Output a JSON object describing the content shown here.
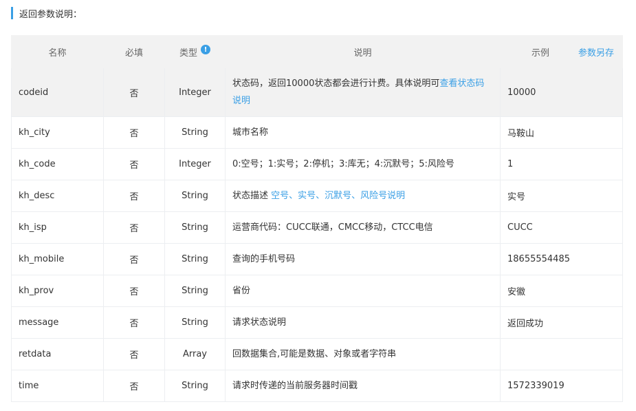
{
  "section": {
    "title": "返回参数说明："
  },
  "header": {
    "name": "名称",
    "required": "必填",
    "type": "类型",
    "info_icon": "!",
    "desc": "说明",
    "example": "示例",
    "copy": "参数另存"
  },
  "rows": [
    {
      "name": "codeid",
      "required": "否",
      "type": "Integer",
      "desc": "状态码，返回10000状态都会进行计费。具体说明可",
      "desc_link": "查看状态码说明",
      "example": "10000"
    },
    {
      "name": "kh_city",
      "required": "否",
      "type": "String",
      "desc": "城市名称",
      "example": "马鞍山"
    },
    {
      "name": "kh_code",
      "required": "否",
      "type": "Integer",
      "desc": "0:空号；1:实号；2:停机；3:库无；4:沉默号；5:风险号",
      "example": "1"
    },
    {
      "name": "kh_desc",
      "required": "否",
      "type": "String",
      "desc": "状态描述 ",
      "desc_link": "空号、实号、沉默号、风险号说明",
      "example": "实号"
    },
    {
      "name": "kh_isp",
      "required": "否",
      "type": "String",
      "desc": "运营商代码：CUCC联通，CMCC移动，CTCC电信",
      "example": "CUCC"
    },
    {
      "name": "kh_mobile",
      "required": "否",
      "type": "String",
      "desc": "查询的手机号码",
      "example": "18655554485"
    },
    {
      "name": "kh_prov",
      "required": "否",
      "type": "String",
      "desc": "省份",
      "example": "安徽"
    },
    {
      "name": "message",
      "required": "否",
      "type": "String",
      "desc": "请求状态说明",
      "example": "返回成功"
    },
    {
      "name": "retdata",
      "required": "否",
      "type": "Array",
      "desc": "回数据集合,可能是数据、对象或者字符串",
      "example": ""
    },
    {
      "name": "time",
      "required": "否",
      "type": "String",
      "desc": "请求时传递的当前服务器时间戳",
      "example": "1572339019"
    }
  ]
}
